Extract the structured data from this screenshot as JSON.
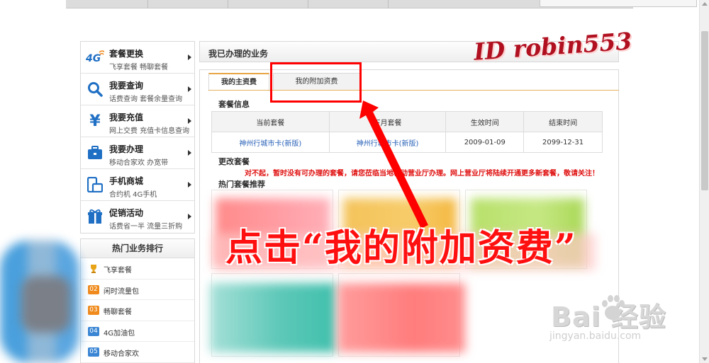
{
  "sidebar": {
    "items": [
      {
        "title": "套餐更换",
        "sub": "飞享套餐 畅聊套餐",
        "icon": "4g-icon"
      },
      {
        "title": "我要查询",
        "sub": "话费查询 套餐余量查询",
        "icon": "search-icon"
      },
      {
        "title": "我要充值",
        "sub": "网上交费 充值卡信息查询",
        "icon": "yuan-icon"
      },
      {
        "title": "我要办理",
        "sub": "移动合家欢 办宽带",
        "icon": "toolbox-icon"
      },
      {
        "title": "手机商城",
        "sub": "合约机 4G手机",
        "icon": "phone-icon"
      },
      {
        "title": "促销活动",
        "sub": "话费省一半 流量三折购",
        "icon": "gift-icon"
      }
    ],
    "badge_4g": "4G",
    "icon_yuan": "¥"
  },
  "hot": {
    "title": "热门业务排行",
    "items": [
      {
        "rank": "",
        "label": "飞享套餐"
      },
      {
        "rank": "02",
        "label": "闲时流量包"
      },
      {
        "rank": "03",
        "label": "畅聊套餐"
      },
      {
        "rank": "04",
        "label": "4G加油包"
      },
      {
        "rank": "05",
        "label": "移动合家欢"
      }
    ]
  },
  "main": {
    "title": "我已办理的业务",
    "tabs": [
      {
        "label": "我的主资费",
        "active": true
      },
      {
        "label": "我的附加资费",
        "active": false
      }
    ],
    "package_info_title": "套餐信息",
    "table": {
      "headers": [
        "当前套餐",
        "下月套餐",
        "生效时间",
        "结束时间"
      ],
      "row": [
        "神州行城市卡(新版)",
        "神州行城市卡(新版)",
        "2009-01-09",
        "2099-12-31"
      ]
    },
    "change_title": "更改套餐",
    "notice": "对不起，暂时没有可办理的套餐，请您莅临当地移动营业厅办理。网上营业厅将陆续开通更多新套餐，敬请关注！",
    "hot_pkg_title": "热门套餐推荐"
  },
  "overlay": {
    "caption": "点击“我的附加资费”",
    "watermark_id": "ID robin553"
  },
  "watermark": {
    "brand": "Bai  经验",
    "url": "jingyan.baidu.com"
  },
  "colors": {
    "highlight": "#ff0000",
    "link": "#2a62b8",
    "tab_accent": "#e6a546"
  }
}
